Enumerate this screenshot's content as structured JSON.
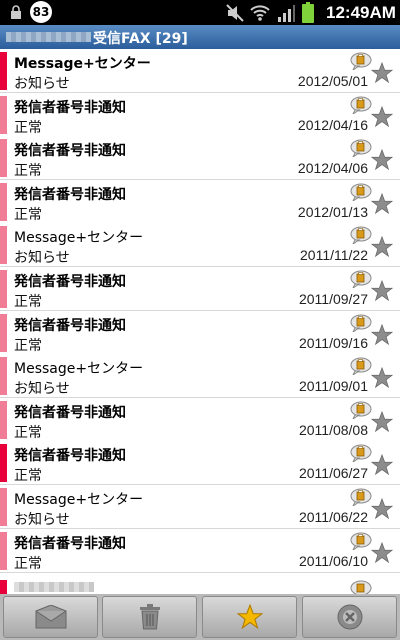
{
  "status_bar": {
    "notification_count": "83",
    "time": "12:49AM",
    "icons": [
      "lock-icon",
      "mute-icon",
      "wifi-icon",
      "signal-icon",
      "battery-icon"
    ]
  },
  "title_bar": {
    "title": "受信FAX [29]"
  },
  "messages": [
    {
      "sender": "Message+センター",
      "subject": "お知らせ",
      "date": "2012/05/01",
      "unread": true
    },
    {
      "sender": "発信者番号非通知",
      "subject": "正常",
      "date": "2012/04/16",
      "unread": true
    },
    {
      "sender": "発信者番号非通知",
      "subject": "正常",
      "date": "2012/04/06",
      "unread": true
    },
    {
      "sender": "発信者番号非通知",
      "subject": "正常",
      "date": "2012/01/13",
      "unread": true
    },
    {
      "sender": "Message+センター",
      "subject": "お知らせ",
      "date": "2011/11/22",
      "unread": false
    },
    {
      "sender": "発信者番号非通知",
      "subject": "正常",
      "date": "2011/09/27",
      "unread": true
    },
    {
      "sender": "発信者番号非通知",
      "subject": "正常",
      "date": "2011/09/16",
      "unread": true
    },
    {
      "sender": "Message+センター",
      "subject": "お知らせ",
      "date": "2011/09/01",
      "unread": false
    },
    {
      "sender": "発信者番号非通知",
      "subject": "正常",
      "date": "2011/08/08",
      "unread": true
    },
    {
      "sender": "発信者番号非通知",
      "subject": "正常",
      "date": "2011/06/27",
      "unread": true
    },
    {
      "sender": "Message+センター",
      "subject": "お知らせ",
      "date": "2011/06/22",
      "unread": false
    },
    {
      "sender": "発信者番号非通知",
      "subject": "正常",
      "date": "2011/06/10",
      "unread": true
    }
  ],
  "toolbar": {
    "buttons": [
      "mail-icon",
      "trash-icon",
      "star-icon",
      "close-icon"
    ]
  },
  "colors": {
    "accent_unread": "#e8003a",
    "accent_read": "#f07c95",
    "title_bar": "#2a5d9a",
    "star": "#f5b800"
  }
}
